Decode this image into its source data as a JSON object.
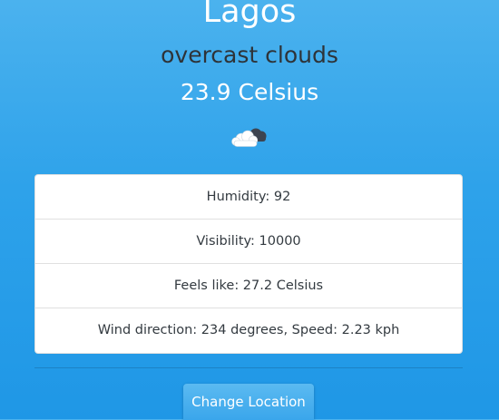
{
  "weather": {
    "city": "Lagos",
    "description": "overcast clouds",
    "temperature": "23.9 Celsius",
    "icon": "overcast-clouds-icon"
  },
  "details": [
    {
      "text": "Humidity: 92"
    },
    {
      "text": "Visibility: 10000"
    },
    {
      "text": "Feels like: 27.2 Celsius"
    },
    {
      "text": "Wind direction: 234 degrees, Speed: 2.23 kph"
    }
  ],
  "actions": {
    "change_location_label": "Change Location"
  },
  "colors": {
    "background_top": "#4bb2ee",
    "background_bottom": "#1f97e6",
    "description_text": "#2e3338",
    "button": "#3aa6eb"
  }
}
